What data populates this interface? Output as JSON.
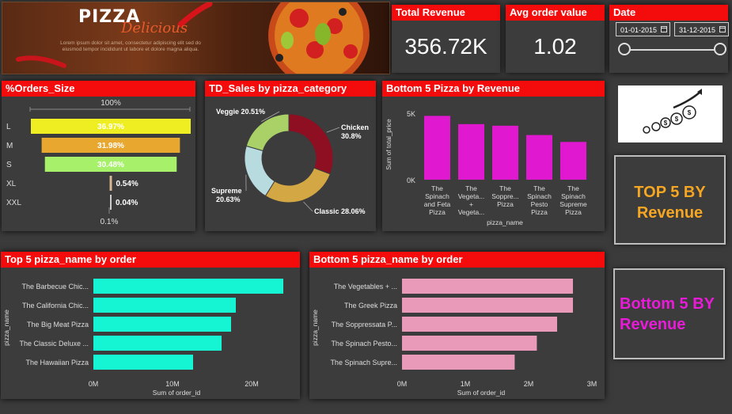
{
  "banner": {
    "title": "PIZZA",
    "script": "Delicious",
    "text": "Lorem ipsum dolor sit amet, consectetur adipiscing elit sed do eiusmod tempor incididunt ut labore et dolore magna aliqua."
  },
  "kpis": {
    "revenue": {
      "title": "Total Revenue",
      "value": "356.72K"
    },
    "aov": {
      "title": "Avg order value",
      "value": "1.02"
    }
  },
  "date_filter": {
    "title": "Date",
    "start": "01-01-2015",
    "end": "31-12-2015"
  },
  "promo": {
    "top_text": "TOP 5 BY Revenue",
    "bottom_text": "Bottom 5 BY Revenue",
    "top_color": "#f5a623",
    "bottom_color": "#e91ad8"
  },
  "chart_data": [
    {
      "id": "orders_size",
      "type": "bar",
      "title": "%Orders_Size",
      "categories": [
        "L",
        "M",
        "S",
        "XL",
        "XXL"
      ],
      "values": [
        36.97,
        31.98,
        30.48,
        0.54,
        0.04
      ],
      "labels": [
        "36.97%",
        "31.98%",
        "30.48%",
        "0.54%",
        "0.04%"
      ],
      "colors": [
        "#eeee22",
        "#e8a830",
        "#a6f06a",
        "#d8b890",
        "#cccccc"
      ],
      "top_label": "100%",
      "bottom_label": "0.1%"
    },
    {
      "id": "sales_category",
      "type": "pie",
      "title": "TD_Sales by pizza_category",
      "categories": [
        "Chicken",
        "Classic",
        "Supreme",
        "Veggie"
      ],
      "values": [
        30.8,
        28.06,
        20.63,
        20.51
      ],
      "labels": [
        "30.8%",
        "28.06%",
        "20.63%",
        "20.51%"
      ],
      "colors": [
        "#8e0f22",
        "#d4a745",
        "#b8dbe0",
        "#a9d167"
      ]
    },
    {
      "id": "bottom5_revenue",
      "type": "bar",
      "title": "Bottom 5 Pizza by Revenue",
      "categories": [
        "The Spinach and Feta Pizza",
        "The Vegeta... + Vegeta...",
        "The Soppre... Pizza",
        "The Spinach Pesto Pizza",
        "The Spinach Supreme Pizza"
      ],
      "values": [
        4800,
        4180,
        4060,
        3360,
        2840
      ],
      "xlabel": "pizza_name",
      "ylabel": "Sum of total_price",
      "y_ticks": [
        "0K",
        "5K"
      ],
      "ylim": [
        0,
        5300
      ],
      "color": "#e019d0"
    },
    {
      "id": "top5_orders",
      "type": "bar",
      "title": "Top 5 pizza_name by order",
      "categories": [
        "The Barbecue Chic...",
        "The California Chic...",
        "The Big Meat Pizza",
        "The Classic Deluxe ...",
        "The Hawaiian Pizza"
      ],
      "values": [
        24000000,
        18000000,
        17400000,
        16200000,
        12600000
      ],
      "xlabel": "Sum of order_id",
      "ylabel": "pizza_name",
      "x_ticks": [
        "0M",
        "10M",
        "20M"
      ],
      "xlim": [
        0,
        25000000
      ],
      "color": "#16f5d3"
    },
    {
      "id": "bottom5_orders",
      "type": "bar",
      "title": "Bottom 5 pizza_name by order",
      "categories": [
        "The Vegetables + ...",
        "The Greek Pizza",
        "The Soppressata P...",
        "The Spinach Pesto...",
        "The Spinach Supre..."
      ],
      "values": [
        2700000,
        2700000,
        2450000,
        2130000,
        1780000
      ],
      "xlabel": "Sum of order_id",
      "ylabel": "pizza_name",
      "x_ticks": [
        "0M",
        "1M",
        "2M",
        "3M"
      ],
      "xlim": [
        0,
        3000000
      ],
      "color": "#e89ab8"
    }
  ]
}
